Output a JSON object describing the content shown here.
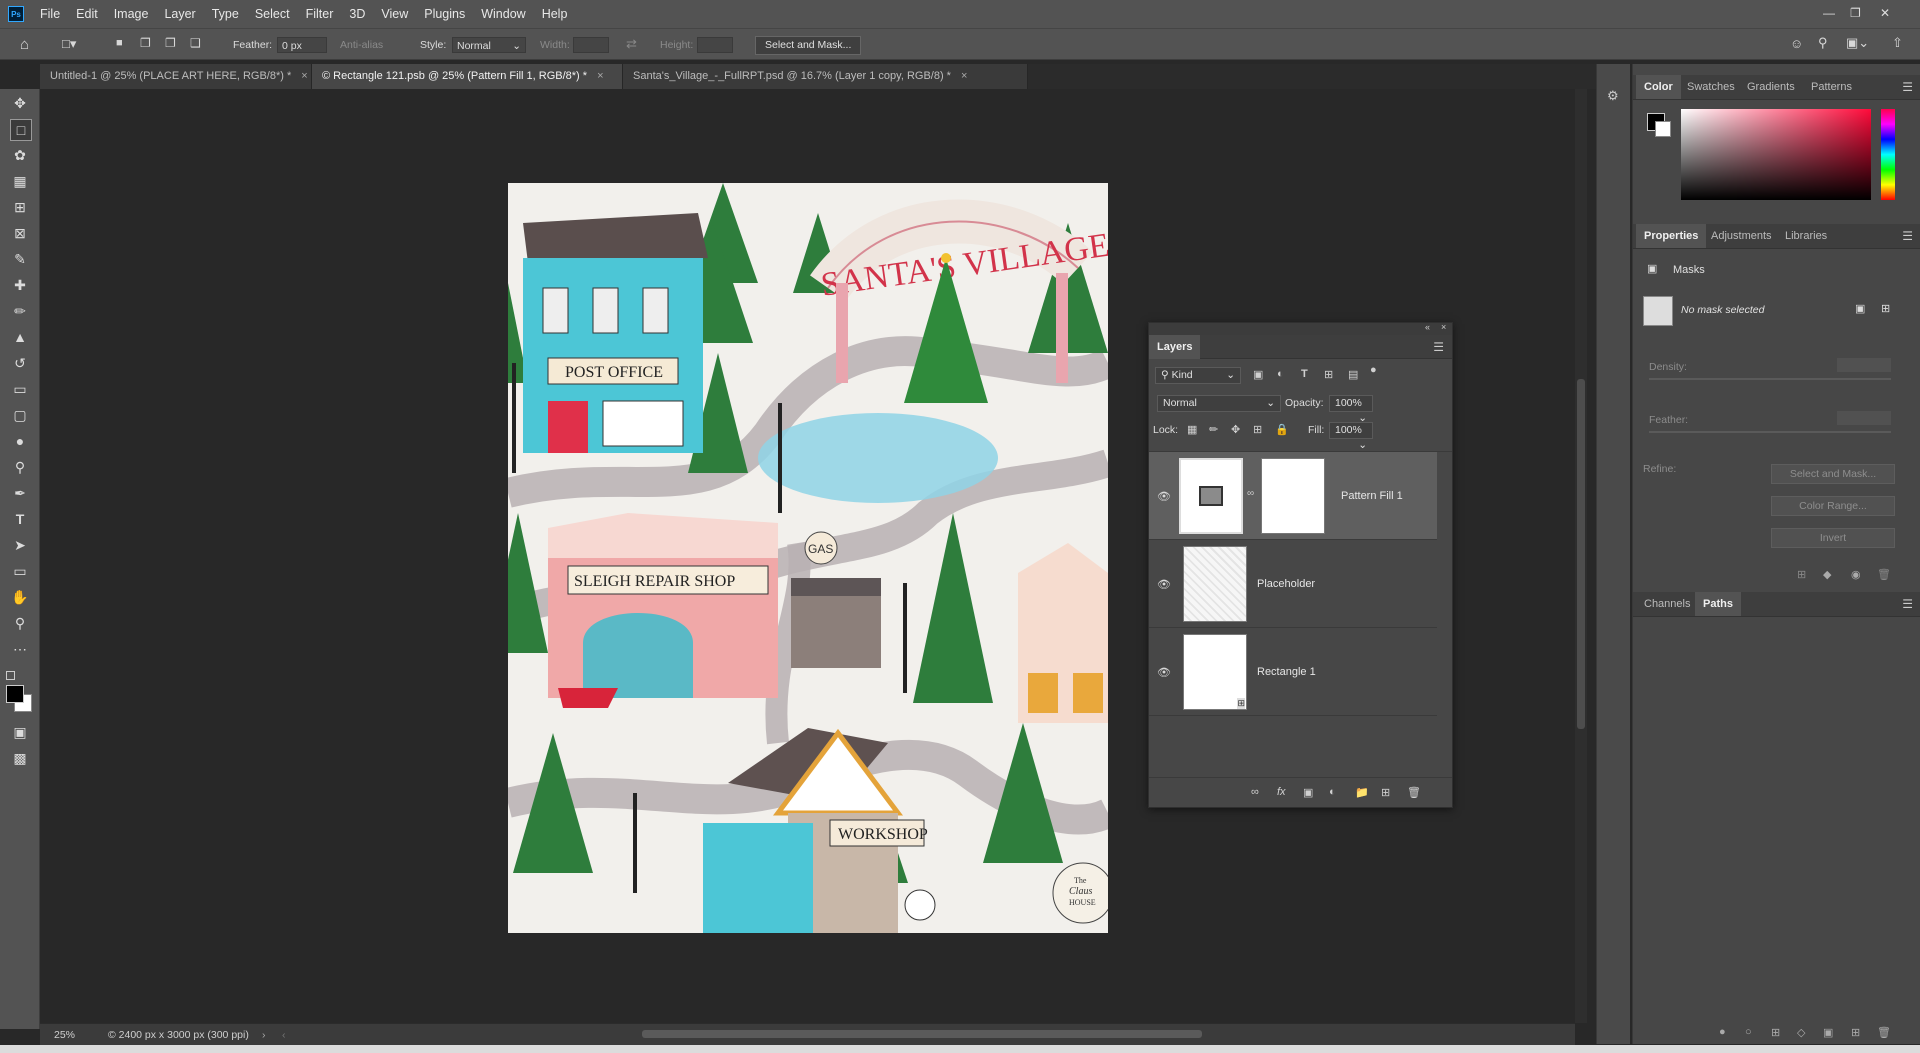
{
  "app": {
    "logo": "Ps"
  },
  "menu": [
    "File",
    "Edit",
    "Image",
    "Layer",
    "Type",
    "Select",
    "Filter",
    "3D",
    "View",
    "Plugins",
    "Window",
    "Help"
  ],
  "options": {
    "feather_label": "Feather:",
    "feather_value": "0 px",
    "antialias_label": "Anti-alias",
    "style_label": "Style:",
    "style_value": "Normal",
    "width_label": "Width:",
    "height_label": "Height:",
    "select_mask_label": "Select and Mask..."
  },
  "tabs": [
    {
      "label": "Untitled-1 @ 25% (PLACE ART HERE, RGB/8*) *",
      "active": false
    },
    {
      "label": "© Rectangle 121.psb @ 25% (Pattern Fill 1, RGB/8*) *",
      "active": true
    },
    {
      "label": "Santa's_Village_-_FullRPT.psd @ 16.7% (Layer 1 copy, RGB/8) *",
      "active": false
    }
  ],
  "artwork": {
    "sign_text": "SANTA'S VILLAGE",
    "post_office": "POST OFFICE",
    "sleigh_shop": "SLEIGH REPAIR SHOP",
    "gas": "GAS",
    "workshop": "WORKSHOP",
    "claus_house_1": "The",
    "claus_house_2": "Claus",
    "claus_house_3": "HOUSE"
  },
  "status": {
    "zoom": "25%",
    "doc_info": "© 2400 px x 3000 px (300 ppi)"
  },
  "color_panel": {
    "tabs": [
      "Color",
      "Swatches",
      "Gradients",
      "Patterns"
    ],
    "active": "Color"
  },
  "properties_panel": {
    "tabs": [
      "Properties",
      "Adjustments",
      "Libraries"
    ],
    "active": "Properties",
    "section": "Masks",
    "no_mask": "No mask selected",
    "density_label": "Density:",
    "feather_label": "Feather:",
    "refine_label": "Refine:",
    "buttons": [
      "Select and Mask...",
      "Color Range...",
      "Invert"
    ]
  },
  "paths_panel": {
    "tabs": [
      "Channels",
      "Paths"
    ],
    "active": "Paths"
  },
  "layers_panel": {
    "title": "Layers",
    "filter_kind": "Kind",
    "blend_mode": "Normal",
    "opacity_label": "Opacity:",
    "opacity_value": "100%",
    "lock_label": "Lock:",
    "fill_label": "Fill:",
    "fill_value": "100%",
    "layers": [
      {
        "name": "Pattern Fill 1",
        "selected": true
      },
      {
        "name": "Placeholder",
        "selected": false
      },
      {
        "name": "Rectangle 1",
        "selected": false
      }
    ]
  },
  "colors": {
    "accent": "#31a8ff",
    "ui_bg": "#535353",
    "canvas_bg": "#282828"
  }
}
